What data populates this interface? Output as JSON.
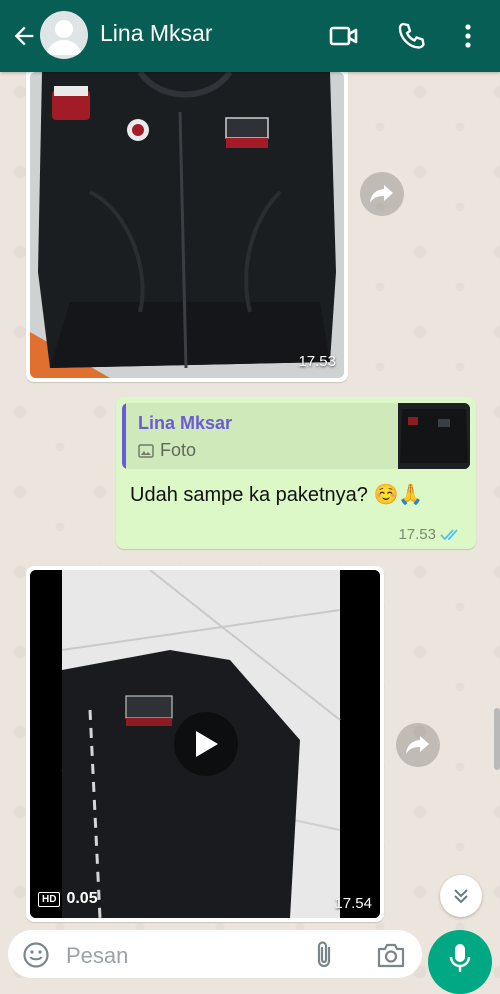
{
  "header": {
    "contact_name": "Lina Mksar"
  },
  "messages": [
    {
      "type": "image",
      "direction": "in",
      "time": "17.53"
    },
    {
      "type": "text",
      "direction": "out",
      "quote": {
        "name": "Lina Mksar",
        "media_label": "Foto"
      },
      "text": "Udah sampe ka paketnya? ☺️🙏",
      "time": "17.53",
      "status": "read"
    },
    {
      "type": "video",
      "direction": "in",
      "duration": "0.05",
      "quality_badge": "HD",
      "time": "17.54"
    }
  ],
  "composer": {
    "placeholder": "Pesan"
  },
  "colors": {
    "header_bg": "#075e54",
    "outgoing_bubble": "#dcf8c6",
    "accent": "#00a884",
    "quote_name": "#6b5bd6",
    "read_ticks": "#4fc3f7"
  }
}
